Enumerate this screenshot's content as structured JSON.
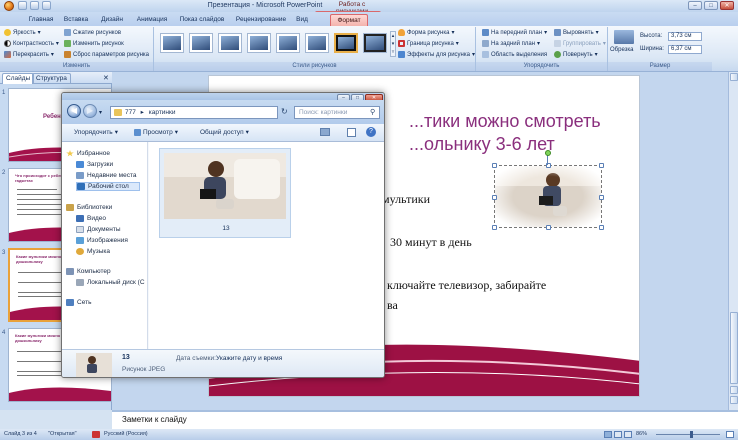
{
  "window": {
    "title": "Презентация - Microsoft PowerPoint",
    "context_title": "Работа с рисунками"
  },
  "ribbon": {
    "tabs": [
      "Главная",
      "Вставка",
      "Дизайн",
      "Анимация",
      "Показ слайдов",
      "Рецензирование",
      "Вид",
      "Формат"
    ],
    "active_tab": "Формат",
    "groups": {
      "adjust": {
        "label": "Изменить",
        "buttons": [
          "Яркость",
          "Контрастность",
          "Перекрасить",
          "Сжатие рисунков",
          "Изменить рисунок",
          "Сброс параметров рисунка"
        ]
      },
      "styles": {
        "label": "Стили рисунков",
        "buttons": [
          "Форма рисунка",
          "Граница рисунка",
          "Эффекты для рисунка"
        ]
      },
      "arrange": {
        "label": "Упорядочить",
        "buttons": [
          "На передний план",
          "На задний план",
          "Область выделения",
          "Выровнять",
          "Группировать",
          "Повернуть"
        ]
      },
      "size": {
        "label": "Размер",
        "crop": "Обрезка",
        "height_label": "Высота:",
        "height_value": "3,73 см",
        "width_label": "Ширина:",
        "width_value": "6,37 см"
      }
    }
  },
  "left_pane": {
    "tabs": [
      "Слайды",
      "Структура"
    ],
    "slides": [
      {
        "num": "1",
        "title": "Ребен..."
      },
      {
        "num": "2",
        "title": "Что происходит с ребенком, если он сидит в гаджетах"
      },
      {
        "num": "3",
        "title": "Какие мультики можно смотреть дошкольнику"
      },
      {
        "num": "4",
        "title": "Какие мультики можно смотреть дошкольнику"
      }
    ]
  },
  "slide": {
    "title_line1": "...тики можно смотреть",
    "title_line2": "...ольнику 3-6 лет",
    "lines": [
      "мультики",
      "30 минут в день",
      "ключайте телевизор, забирайте",
      "ва"
    ]
  },
  "notes": {
    "placeholder": "Заметки к слайду"
  },
  "status": {
    "slide": "Слайд 3 из 4",
    "theme": "\"Открытая\"",
    "language": "Русский (Россия)",
    "zoom": "86%"
  },
  "explorer": {
    "path_parent": "777",
    "path_current": "картинки",
    "search_placeholder": "Поиск: картинки",
    "toolbar": [
      "Упорядочить",
      "Просмотр",
      "Общий доступ"
    ],
    "nav": {
      "favorites": "Избранное",
      "downloads": "Загрузки",
      "recent": "Недавние места",
      "desktop": "Рабочий стол",
      "libraries": "Библиотеки",
      "video": "Видео",
      "documents": "Документы",
      "images": "Изображения",
      "music": "Музыка",
      "computer": "Компьютер",
      "local_disk": "Локальный диск (С",
      "network": "Сеть"
    },
    "file": {
      "name": "13",
      "type": "Рисунок JPEG"
    },
    "details": {
      "date_label": "Дата съемки:",
      "date_value": "Укажите дату и время"
    }
  },
  "colors": {
    "accent": "#8a2f7d",
    "ribbon": "#dbe7f5",
    "context_tab": "#f3b3ad"
  }
}
